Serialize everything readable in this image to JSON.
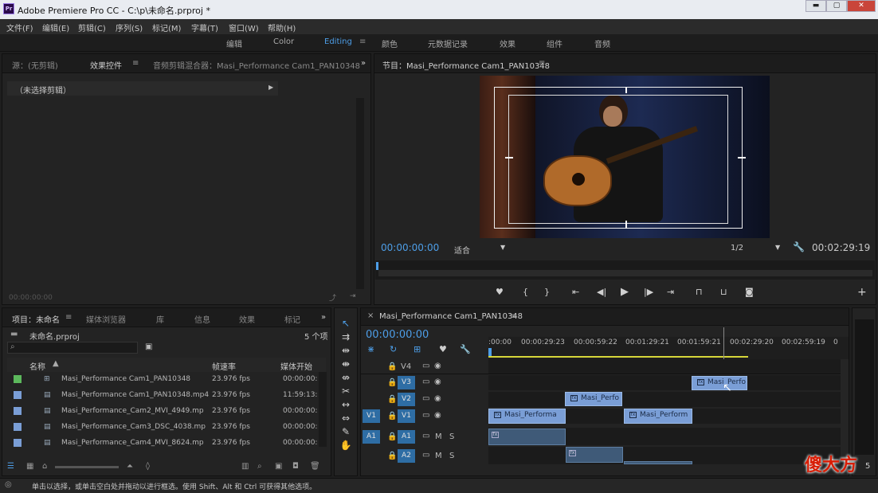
{
  "window": {
    "title": "Adobe Premiere Pro CC - C:\\p\\未命名.prproj *",
    "app_icon": "Pr",
    "min": "▬",
    "max": "▢",
    "close": "✕"
  },
  "menu": [
    "文件(F)",
    "编辑(E)",
    "剪辑(C)",
    "序列(S)",
    "标记(M)",
    "字幕(T)",
    "窗口(W)",
    "帮助(H)"
  ],
  "workspaces": [
    "编辑",
    "Color",
    "Editing",
    "颜色",
    "元数据记录",
    "效果",
    "组件",
    "音频"
  ],
  "active_workspace": "Editing",
  "effects_panel": {
    "tabs": [
      "源：(无剪辑)",
      "效果控件",
      "音频剪辑混合器：Masi_Performance Cam1_PAN10348"
    ],
    "active_tab": "效果控件",
    "no_clip": "（未选择剪辑）",
    "timecode": "00:00:00:00"
  },
  "program": {
    "title": "节目：Masi_Performance Cam1_PAN10348",
    "timecode": "00:00:00:00",
    "fit": "适合",
    "resolution": "1/2",
    "duration": "00:02:29:19"
  },
  "project": {
    "tabs": [
      "项目：未命名",
      "媒体浏览器",
      "库",
      "信息",
      "效果",
      "标记"
    ],
    "file": "未命名.prproj",
    "count": "5 个项",
    "search_placeholder": "",
    "headers": [
      "名称",
      "帧速率",
      "媒体开始"
    ],
    "items": [
      {
        "name": "Masi_Performance Cam1_PAN10348",
        "fps": "23.976 fps",
        "start": "00:00:00:",
        "color": "#5cb85c"
      },
      {
        "name": "Masi_Performance Cam1_PAN10348.mp4",
        "fps": "23.976 fps",
        "start": "11:59:13:",
        "color": "#7a9ed6"
      },
      {
        "name": "Masi_Performance_Cam2_MVI_4949.mp",
        "fps": "23.976 fps",
        "start": "00:00:00:",
        "color": "#7a9ed6"
      },
      {
        "name": "Masi_Performance_Cam3_DSC_4038.mp",
        "fps": "23.976 fps",
        "start": "00:00:00:",
        "color": "#7a9ed6"
      },
      {
        "name": "Masi_Performance_Cam4_MVI_8624.mp",
        "fps": "23.976 fps",
        "start": "00:00:00:",
        "color": "#7a9ed6"
      }
    ]
  },
  "timeline": {
    "title": "Masi_Performance Cam1_PAN10348",
    "timecode": "00:00:00:00",
    "ruler": [
      ":00:00",
      "00:00:29:23",
      "00:00:59:22",
      "00:01:29:21",
      "00:01:59:21",
      "00:02:29:20",
      "00:02:59:19",
      "0"
    ],
    "tracks": {
      "V4": "V4",
      "V3": "V3",
      "V2": "V2",
      "V1": "V1",
      "A1": "A1",
      "A2": "A2",
      "src_v1": "V1",
      "src_a1": "A1",
      "m": "M",
      "s": "S"
    },
    "clips": {
      "v3": "Masi_Perfo",
      "v2": "Masi_Perfo",
      "v1a": "Masi_Performa",
      "v1b": "Masi_Perform"
    }
  },
  "status": "单击以选择，或单击空白处并拖动以进行框选。使用 Shift、Alt 和 Ctrl 可获得其他选项。",
  "watermark": "傻大方",
  "scroll_badge": "5"
}
